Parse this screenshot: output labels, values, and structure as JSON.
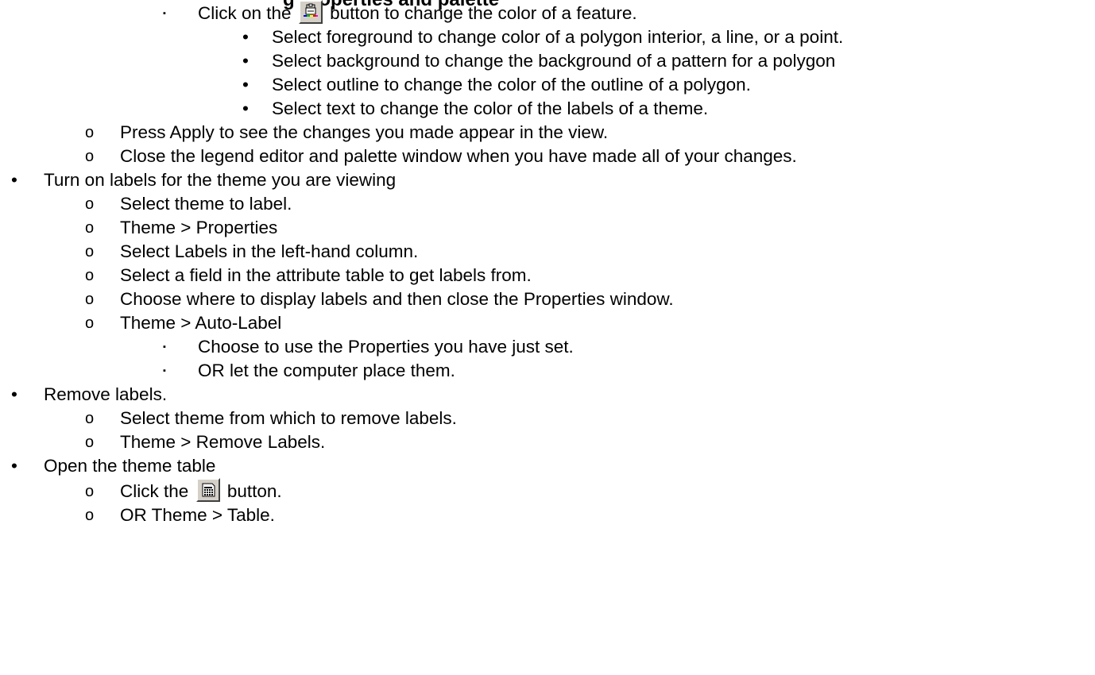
{
  "heading_partial": "g properties and palette",
  "lines": [
    {
      "text_before": "Click on the",
      "icon": "color-palette-icon",
      "text_after": "button to change the color of a feature."
    },
    {
      "text": "Select foreground to change color of a polygon interior, a line, or a point."
    },
    {
      "text": "Select background to change the background of a pattern for a polygon"
    },
    {
      "text": "Select outline to change the color of the outline of a polygon."
    },
    {
      "text": "Select text to change the color of the labels of a theme."
    },
    {
      "text": "Press Apply to see the changes you made appear in the view."
    },
    {
      "text": "Close the legend editor and palette window when you have made all of your changes."
    },
    {
      "text": "Turn on labels for the theme you are viewing"
    },
    {
      "text": "Select theme to label."
    },
    {
      "text": "Theme > Properties"
    },
    {
      "text": "Select Labels in the left-hand column."
    },
    {
      "text": "Select a field in the attribute table to get labels from."
    },
    {
      "text": "Choose where to display labels and then close the Properties window."
    },
    {
      "text": "Theme > Auto-Label"
    },
    {
      "text": "Choose to use the Properties you have just set."
    },
    {
      "text": "OR let the computer place them."
    },
    {
      "text": "Remove labels."
    },
    {
      "text": "Select theme from which to remove labels."
    },
    {
      "text": "Theme > Remove Labels."
    },
    {
      "text": "Open the theme table"
    },
    {
      "text_before": "Click the",
      "icon": "table-icon",
      "text_after": "button."
    },
    {
      "text": "OR Theme > Table."
    }
  ],
  "bullets": {
    "square": "▪",
    "dot": "•",
    "circle": "o"
  }
}
